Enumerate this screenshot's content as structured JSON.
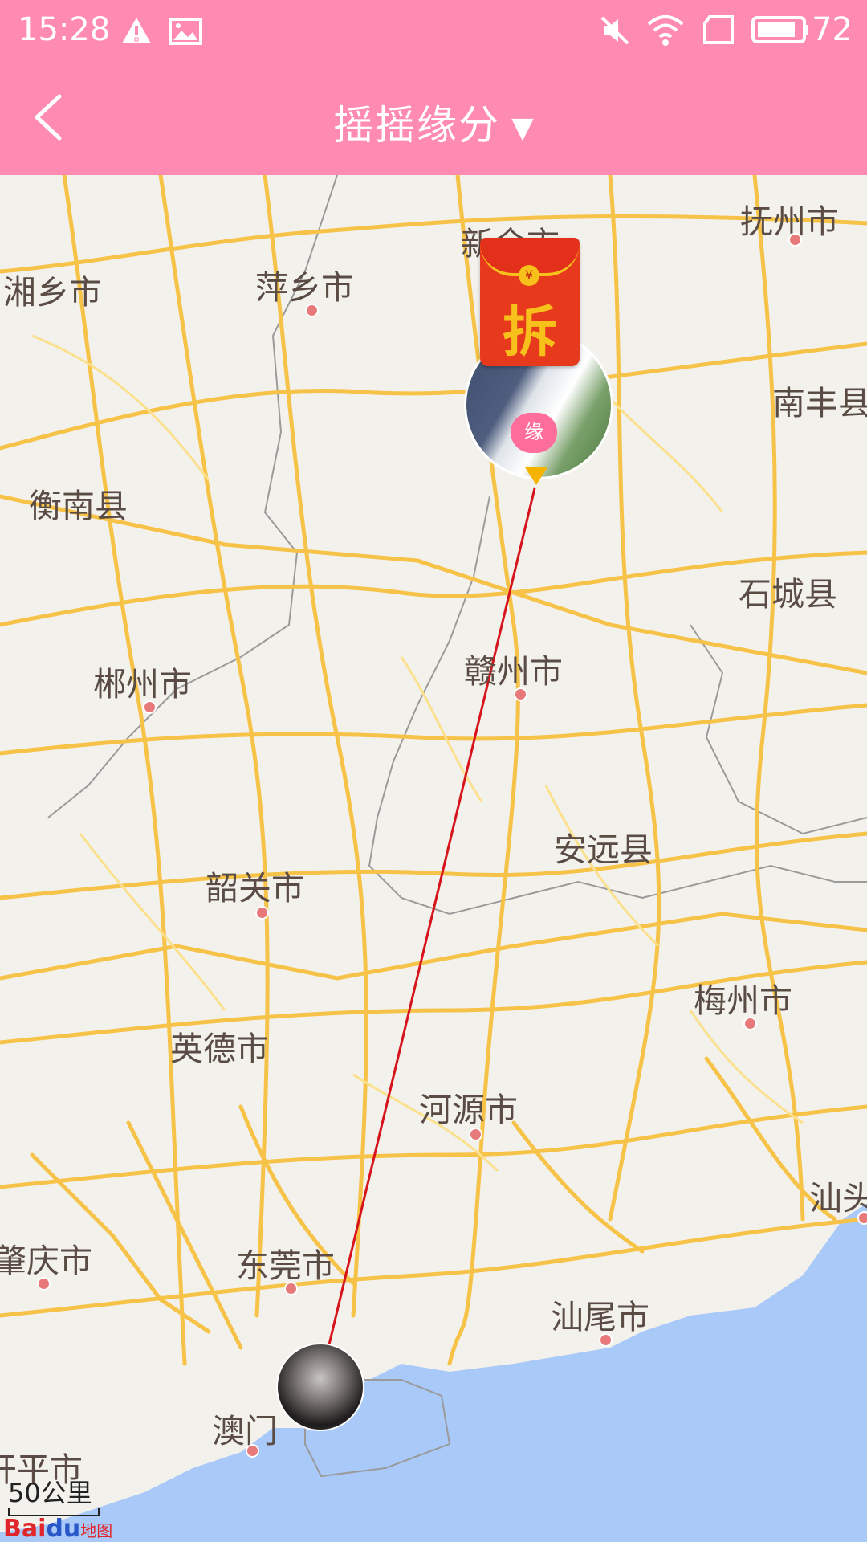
{
  "status_bar": {
    "time": "15:28",
    "battery": "72",
    "icons": [
      "warning-icon",
      "image-icon",
      "mute-icon",
      "wifi-icon",
      "sim-icon",
      "battery-icon"
    ]
  },
  "header": {
    "title": "摇摇缘分",
    "caret": "▼"
  },
  "map": {
    "cities": [
      {
        "name": "新余市"
      },
      {
        "name": "抚州市"
      },
      {
        "name": "湘乡市"
      },
      {
        "name": "萍乡市"
      },
      {
        "name": "南丰县"
      },
      {
        "name": "衡南县"
      },
      {
        "name": "石城县"
      },
      {
        "name": "赣州市"
      },
      {
        "name": "郴州市"
      },
      {
        "name": "安远县"
      },
      {
        "name": "韶关市"
      },
      {
        "name": "梅州市"
      },
      {
        "name": "英德市"
      },
      {
        "name": "河源市"
      },
      {
        "name": "汕头"
      },
      {
        "name": "肇庆市"
      },
      {
        "name": "东莞市"
      },
      {
        "name": "汕尾市"
      },
      {
        "name": "澳门"
      },
      {
        "name": "开平市"
      }
    ],
    "red_packet_label": "拆",
    "red_packet_coin": "¥",
    "badge_label": "缘",
    "scale_label": "50公里",
    "logo_bai": "Bai",
    "logo_du": "du",
    "logo_map": "地图"
  },
  "colors": {
    "accent": "#ff8ab2",
    "road": "#f6c348",
    "water": "#a9c9f8",
    "line": "#d7131b",
    "red_packet": "#e73a1d"
  }
}
